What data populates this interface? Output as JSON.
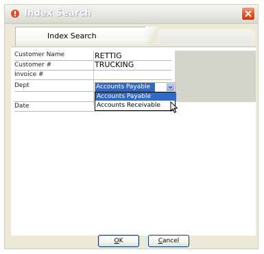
{
  "window": {
    "title": "Index Search"
  },
  "tabs": [
    {
      "label": "Index Search"
    }
  ],
  "form": {
    "fields": [
      {
        "label": "Customer Name",
        "value": "RETTIG TRUCKING"
      },
      {
        "label": "Customer #",
        "value": ""
      },
      {
        "label": "Invoice #",
        "value": ""
      },
      {
        "label": "Dept",
        "value": "Accounts Payable"
      },
      {
        "label": "",
        "value": ""
      },
      {
        "label": "Date",
        "value": ""
      }
    ],
    "dept_options": [
      "Accounts Payable",
      "Accounts Receivable"
    ]
  },
  "buttons": {
    "ok_prefix": "",
    "ok_ul": "O",
    "ok_rest": "K",
    "cancel_ul": "C",
    "cancel_rest": "ancel"
  },
  "colors": {
    "selection": "#316ac5",
    "close": "#e0582e",
    "titlebar": "#e6e6e0"
  }
}
